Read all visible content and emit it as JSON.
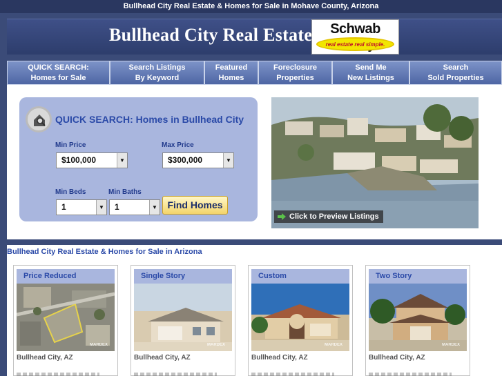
{
  "top_bar": {
    "text": "Bullhead City Real Estate & Homes for Sale in Mohave County, Arizona"
  },
  "header": {
    "title": "Bullhead City Real Estate",
    "logo_name": "Schwab Realty",
    "logo_tagline": "real estate real simple."
  },
  "nav": [
    {
      "line1": "QUICK SEARCH:",
      "line2": "Homes for Sale"
    },
    {
      "line1": "Search Listings",
      "line2": "By Keyword"
    },
    {
      "line1": "Featured",
      "line2": "Homes"
    },
    {
      "line1": "Foreclosure",
      "line2": "Properties"
    },
    {
      "line1": "Send Me",
      "line2": "New Listings"
    },
    {
      "line1": "Search",
      "line2": "Sold Properties"
    }
  ],
  "quick_search": {
    "icon": "house-search-icon",
    "title": "QUICK SEARCH: Homes in Bullhead City",
    "min_price_label": "Min Price",
    "min_price_value": "$100,000",
    "max_price_label": "Max Price",
    "max_price_value": "$300,000",
    "min_beds_label": "Min Beds",
    "min_beds_value": "1",
    "min_baths_label": "Min Baths",
    "min_baths_value": "1",
    "button": "Find Homes"
  },
  "preview": {
    "label": "Click to Preview Listings"
  },
  "section_title": "Bullhead City Real Estate & Homes for Sale in Arizona",
  "cards": [
    {
      "title": "Price Reduced",
      "location": "Bullhead City, AZ",
      "watermark": "MARDEX"
    },
    {
      "title": "Single Story",
      "location": "Bullhead City, AZ",
      "watermark": "MARDEX"
    },
    {
      "title": "Custom",
      "location": "Bullhead City, AZ",
      "watermark": "MARDEX"
    },
    {
      "title": "Two Story",
      "location": "Bullhead City, AZ",
      "watermark": "MARDEX"
    }
  ],
  "colors": {
    "page_bg": "#3b4b78",
    "accent_blue": "#2b4aa8",
    "panel_blue": "#a9b6de",
    "button_gold": "#f3d46a"
  }
}
